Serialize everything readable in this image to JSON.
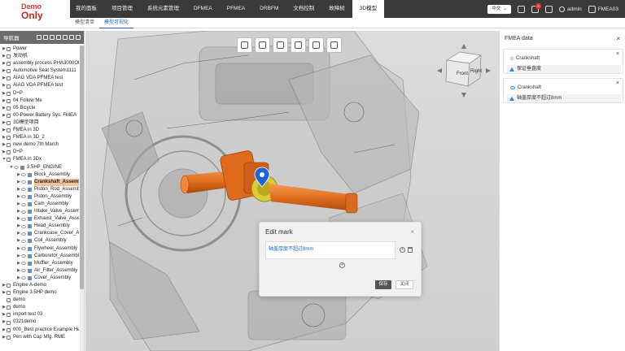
{
  "logo": {
    "line1": "Demo",
    "line2": "Only"
  },
  "topnav": [
    "我的面板",
    "项目管理",
    "系统元素管理",
    "DFMEA",
    "PFMEA",
    "DRBFM",
    "文档控制",
    "故障树",
    "3D模型"
  ],
  "topnav_active": 8,
  "topright": {
    "language": "中文",
    "language_caret": "⌄",
    "notification_count": "2",
    "user": "admin",
    "project": "FMEA03"
  },
  "subnav": [
    "模型清单",
    "模型可视化"
  ],
  "subnav_active": 1,
  "sidebar": {
    "title": "导航器",
    "tree": [
      {
        "label": "Power",
        "level": 0,
        "arrow": "▶",
        "type": "folder"
      },
      {
        "label": "发动机",
        "level": 0,
        "arrow": "▶",
        "type": "folder"
      },
      {
        "label": "assembly process PHA3000OF",
        "level": 0,
        "arrow": "▶",
        "type": "folder"
      },
      {
        "label": "Automotive Seat System1111",
        "level": 0,
        "arrow": "▶",
        "type": "folder"
      },
      {
        "label": "AIAG VDA PFMEA test",
        "level": 0,
        "arrow": "▶",
        "type": "folder"
      },
      {
        "label": "AIAG VDA PFMEA test",
        "level": 0,
        "arrow": "▶",
        "type": "folder"
      },
      {
        "label": "D+P",
        "level": 0,
        "arrow": "▶",
        "type": "folder"
      },
      {
        "label": "04 Follow Me",
        "level": 0,
        "arrow": "▶",
        "type": "folder"
      },
      {
        "label": "05 Bicycle",
        "level": 0,
        "arrow": "▶",
        "type": "folder"
      },
      {
        "label": "00-Power Battery Sys. FMEA",
        "level": 0,
        "arrow": "▶",
        "type": "folder"
      },
      {
        "label": "3D模型项目",
        "level": 0,
        "arrow": "▶",
        "type": "folder"
      },
      {
        "label": "FMEA in 3D",
        "level": 0,
        "arrow": "▶",
        "type": "folder"
      },
      {
        "label": "FMEA in 3D_2",
        "level": 0,
        "arrow": "▶",
        "type": "folder"
      },
      {
        "label": "new demo 7th March",
        "level": 0,
        "arrow": "▶",
        "type": "folder"
      },
      {
        "label": "D+P",
        "level": 0,
        "arrow": "▶",
        "type": "folder"
      },
      {
        "label": "FMEA in 3Dx",
        "level": 0,
        "arrow": "▼",
        "type": "folder"
      },
      {
        "label": "3.5HP_ENGINE",
        "level": 1,
        "arrow": "▼",
        "type": "part"
      },
      {
        "label": "Block_Assembly",
        "level": 2,
        "arrow": "▶",
        "type": "part"
      },
      {
        "label": "Crankshaft_Assembly",
        "level": 2,
        "arrow": "▶",
        "type": "part",
        "selected": true
      },
      {
        "label": "Piston_Rod_Assembly",
        "level": 2,
        "arrow": "▶",
        "type": "part"
      },
      {
        "label": "Piston_Assembly",
        "level": 2,
        "arrow": "▶",
        "type": "part"
      },
      {
        "label": "Cam_Assembly",
        "level": 2,
        "arrow": "▶",
        "type": "part"
      },
      {
        "label": "Intake_Valve_Assembly",
        "level": 2,
        "arrow": "▶",
        "type": "part"
      },
      {
        "label": "Exhaust_Valve_Assembly",
        "level": 2,
        "arrow": "▶",
        "type": "part"
      },
      {
        "label": "Head_Assembly",
        "level": 2,
        "arrow": "▶",
        "type": "part"
      },
      {
        "label": "Crankcase_Cover_Assembly",
        "level": 2,
        "arrow": "▶",
        "type": "part"
      },
      {
        "label": "Coil_Assembly",
        "level": 2,
        "arrow": "▶",
        "type": "part"
      },
      {
        "label": "Flywheel_Assembly",
        "level": 2,
        "arrow": "▶",
        "type": "part"
      },
      {
        "label": "Carburetor_Assembly",
        "level": 2,
        "arrow": "▶",
        "type": "part"
      },
      {
        "label": "Muffler_Assembly",
        "level": 2,
        "arrow": "▶",
        "type": "part"
      },
      {
        "label": "Air_Filter_Assembly",
        "level": 2,
        "arrow": "▶",
        "type": "part"
      },
      {
        "label": "Cover_Assembly",
        "level": 2,
        "arrow": "▶",
        "type": "part"
      },
      {
        "label": "Engine A-demo",
        "level": 0,
        "arrow": "▶",
        "type": "folder"
      },
      {
        "label": "Engine 3.5HP demo",
        "level": 0,
        "arrow": "▶",
        "type": "folder"
      },
      {
        "label": "demo",
        "level": 0,
        "arrow": "",
        "type": "folder"
      },
      {
        "label": "demo",
        "level": 0,
        "arrow": "▶",
        "type": "folder"
      },
      {
        "label": "import test 03",
        "level": 0,
        "arrow": "▶",
        "type": "folder"
      },
      {
        "label": "0321demo",
        "level": 0,
        "arrow": "▶",
        "type": "folder"
      },
      {
        "label": "000_Best practice Example Head",
        "level": 0,
        "arrow": "▶",
        "type": "folder"
      },
      {
        "label": "Pen with Cap Mfg. RME",
        "level": 0,
        "arrow": "▶",
        "type": "folder"
      }
    ]
  },
  "viewport": {
    "toolbar_icons": [
      "structure-tree-icon",
      "fit-view-icon",
      "zoom-icon",
      "cube-view-icon",
      "document-icon",
      "edit-note-icon"
    ],
    "navcube": {
      "front": "Front",
      "right": "Right"
    }
  },
  "edit_mark": {
    "title": "Edit mark",
    "close": "×",
    "input_value": "轴盖厚度不超过8mm",
    "plus": "+",
    "save_label": "保存",
    "cancel_label": "关闭"
  },
  "fmea_panel": {
    "title": "FMEA data",
    "close": "×",
    "cards": [
      {
        "name": "Crankshaft",
        "desc": "保证垂直度",
        "close": "×",
        "visible": false
      },
      {
        "name": "Crankshaft",
        "desc": "轴盖厚度不超过8mm",
        "close": "×",
        "visible": true
      }
    ]
  },
  "colors": {
    "topbar": "#3a3a3a",
    "accent": "#1565c0",
    "part_orange": "#e5762b",
    "selected_row": "#f5c39a",
    "sidebar_header": "#6b6b6b"
  }
}
